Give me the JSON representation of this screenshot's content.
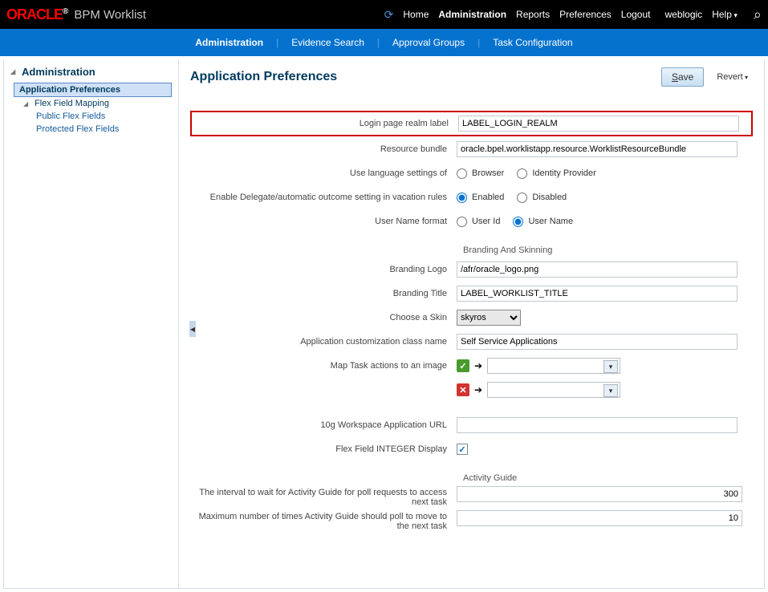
{
  "header": {
    "logo_text": "ORACLE",
    "app_title": "BPM Worklist",
    "nav": [
      "Home",
      "Administration",
      "Reports",
      "Preferences",
      "Logout"
    ],
    "active_nav": "Administration",
    "user": "weblogic",
    "help": "Help"
  },
  "subnav": {
    "items": [
      "Administration",
      "Evidence Search",
      "Approval Groups",
      "Task Configuration"
    ],
    "active": "Administration"
  },
  "sidebar": {
    "title": "Administration",
    "items": [
      {
        "label": "Application Preferences",
        "selected": true
      },
      {
        "label": "Flex Field Mapping",
        "expandable": true
      },
      {
        "label": "Public Flex Fields",
        "child": true
      },
      {
        "label": "Protected Flex Fields",
        "child": true
      }
    ]
  },
  "content": {
    "title": "Application Preferences",
    "save": "Save",
    "revert": "Revert"
  },
  "form": {
    "login_realm_label": "Login page realm label",
    "login_realm_value": "LABEL_LOGIN_REALM",
    "resource_bundle_label": "Resource bundle",
    "resource_bundle_value": "oracle.bpel.worklistapp.resource.WorklistResourceBundle",
    "lang_label": "Use language settings of",
    "lang_opt1": "Browser",
    "lang_opt2": "Identity Provider",
    "delegate_label": "Enable Delegate/automatic outcome setting in vacation rules",
    "delegate_opt1": "Enabled",
    "delegate_opt2": "Disabled",
    "username_label": "User Name format",
    "username_opt1": "User Id",
    "username_opt2": "User Name",
    "branding_section": "Branding And Skinning",
    "branding_logo_label": "Branding Logo",
    "branding_logo_value": "/afr/oracle_logo.png",
    "branding_title_label": "Branding Title",
    "branding_title_value": "LABEL_WORKLIST_TITLE",
    "skin_label": "Choose a Skin",
    "skin_value": "skyros",
    "custom_class_label": "Application customization class name",
    "custom_class_value": "Self Service Applications",
    "map_task_label": "Map Task actions to an image",
    "tenq_url_label": "10g Workspace Application URL",
    "tenq_url_value": "",
    "flex_int_label": "Flex Field INTEGER Display",
    "activity_section": "Activity Guide",
    "ag_interval_label": "The interval to wait for Activity Guide for poll requests to access next task",
    "ag_interval_value": "300",
    "ag_max_label": "Maximum number of times Activity Guide should poll to move to the next task",
    "ag_max_value": "10"
  }
}
